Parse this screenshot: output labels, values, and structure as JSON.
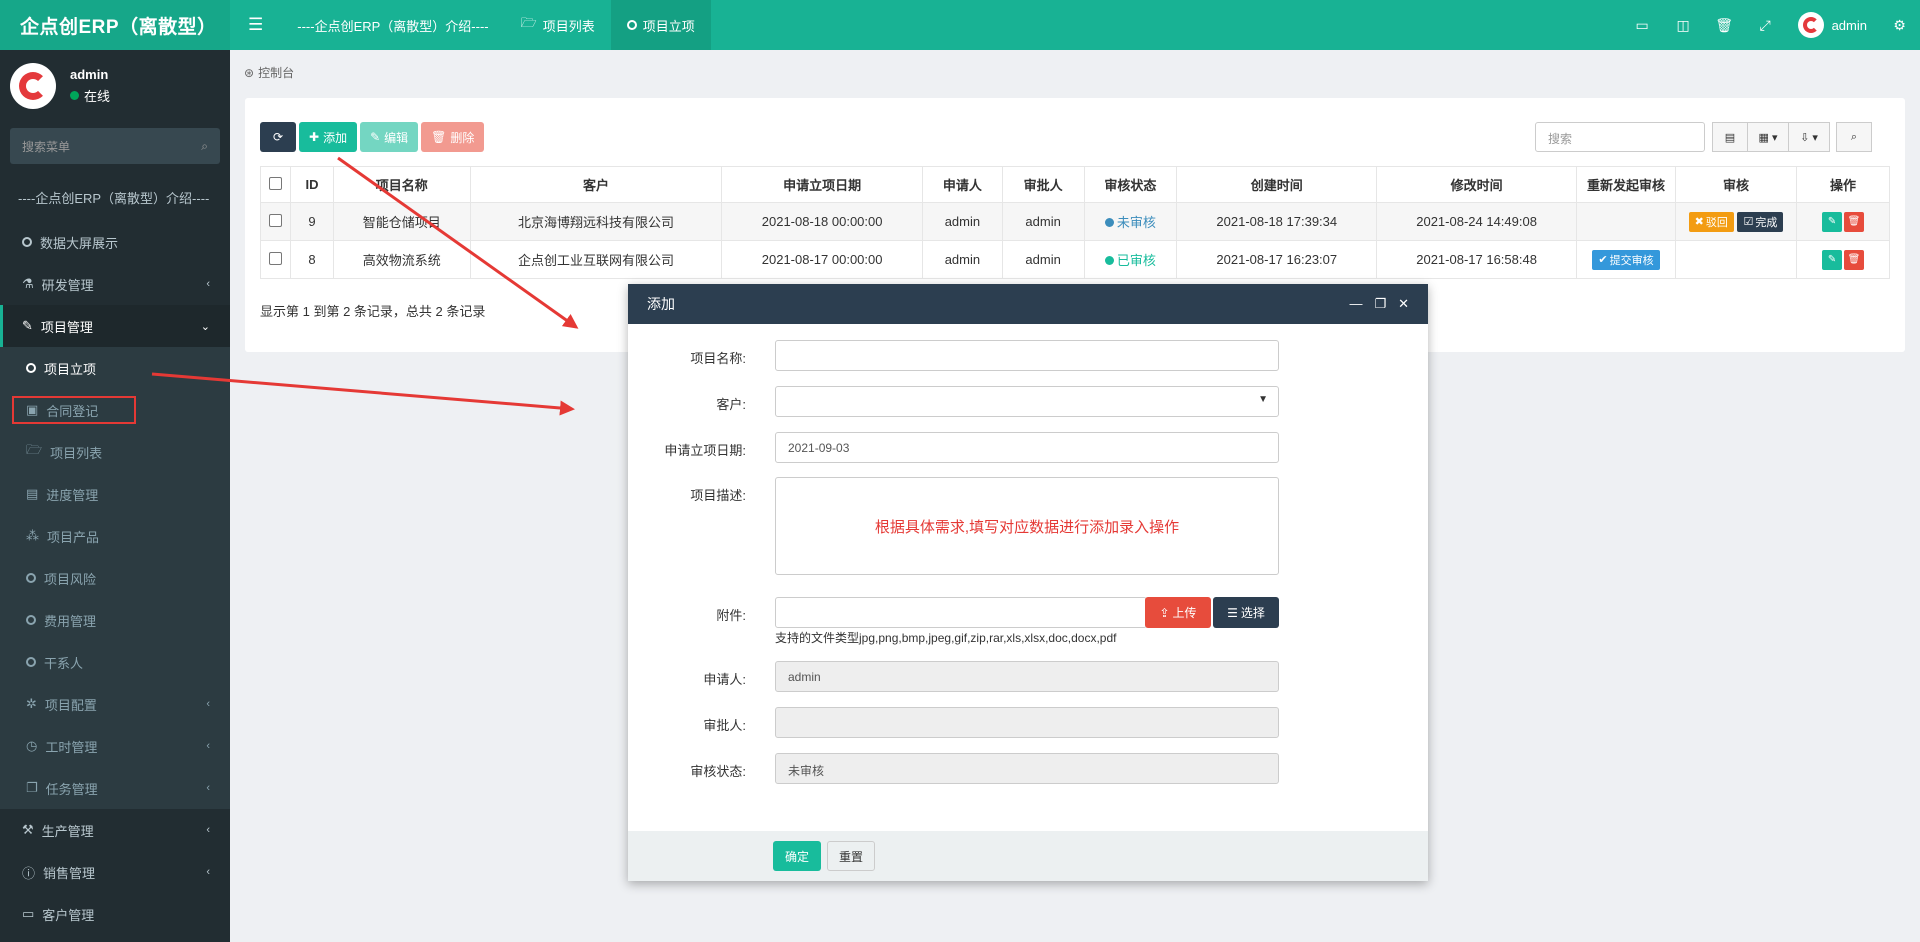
{
  "app": {
    "title": "企点创ERP（离散型）"
  },
  "topnav": {
    "items": [
      {
        "label": "----企点创ERP（离散型）介绍----",
        "active": false
      },
      {
        "label": "项目列表",
        "active": false
      },
      {
        "label": "项目立项",
        "active": true
      }
    ],
    "user": "admin"
  },
  "sidebar": {
    "user": {
      "name": "admin",
      "status": "在线"
    },
    "search_placeholder": "搜索菜单",
    "header": "----企点创ERP（离散型）介绍----",
    "items": [
      {
        "label": "数据大屏展示",
        "icon": "circle-icon"
      },
      {
        "label": "研发管理",
        "icon": "flask-icon",
        "has_caret": true
      },
      {
        "label": "项目管理",
        "icon": "edit-icon",
        "open": true
      }
    ],
    "sub_items": [
      {
        "label": "项目立项",
        "icon": "circle-icon",
        "active": true
      },
      {
        "label": "合同登记",
        "icon": "calendar-check-icon"
      },
      {
        "label": "项目列表",
        "icon": "folder-open-icon"
      },
      {
        "label": "进度管理",
        "icon": "file-icon"
      },
      {
        "label": "项目产品",
        "icon": "cubes-icon"
      },
      {
        "label": "项目风险",
        "icon": "circle-icon"
      },
      {
        "label": "费用管理",
        "icon": "circle-icon"
      },
      {
        "label": "干系人",
        "icon": "circle-icon"
      },
      {
        "label": "项目配置",
        "icon": "gear-icon"
      },
      {
        "label": "工时管理",
        "icon": "clock-icon"
      },
      {
        "label": "任务管理",
        "icon": "copy-icon"
      }
    ],
    "bottom_items": [
      {
        "label": "生产管理",
        "icon": "gavel-icon"
      },
      {
        "label": "销售管理",
        "icon": "info-icon"
      },
      {
        "label": "客户管理",
        "icon": "id-card-icon"
      }
    ]
  },
  "breadcrumb": "控制台",
  "toolbar": {
    "add": "添加",
    "edit": "编辑",
    "delete": "删除",
    "search_placeholder": "搜索"
  },
  "table": {
    "headers": [
      "ID",
      "项目名称",
      "客户",
      "申请立项日期",
      "申请人",
      "审批人",
      "审核状态",
      "创建时间",
      "修改时间",
      "重新发起审核",
      "审核",
      "操作"
    ],
    "rows": [
      {
        "id": "9",
        "name": "智能仓储项目",
        "customer": "北京海博翔远科技有限公司",
        "date": "2021-08-18 00:00:00",
        "applicant": "admin",
        "approver": "admin",
        "status": "未审核",
        "created": "2021-08-18 17:39:34",
        "modified": "2021-08-24 14:49:08",
        "reject": "驳回",
        "done": "完成"
      },
      {
        "id": "8",
        "name": "高效物流系统",
        "customer": "企点创工业互联网有限公司",
        "date": "2021-08-17 00:00:00",
        "applicant": "admin",
        "approver": "admin",
        "status": "已审核",
        "created": "2021-08-17 16:23:07",
        "modified": "2021-08-17 16:58:48",
        "resubmit": "提交审核"
      }
    ],
    "pager": "显示第 1 到第 2 条记录，总共 2 条记录"
  },
  "colors": {
    "primary": "#18b294",
    "sidebar": "#222d32",
    "modal_header": "#2c3e50",
    "danger": "#e74c3c",
    "annotation": "#e53935"
  },
  "modal": {
    "title": "添加",
    "fields": {
      "name_label": "项目名称:",
      "customer_label": "客户:",
      "date_label": "申请立项日期:",
      "date_value": "2021-09-03",
      "desc_label": "项目描述:",
      "desc_hint": "根据具体需求,填写对应数据进行添加录入操作",
      "attach_label": "附件:",
      "upload": "上传",
      "choose": "选择",
      "file_types": "支持的文件类型jpg,png,bmp,jpeg,gif,zip,rar,xls,xlsx,doc,docx,pdf",
      "applicant_label": "申请人:",
      "applicant_value": "admin",
      "approver_label": "审批人:",
      "status_label": "审核状态:",
      "status_value": "未审核"
    },
    "confirm": "确定",
    "reset": "重置"
  }
}
